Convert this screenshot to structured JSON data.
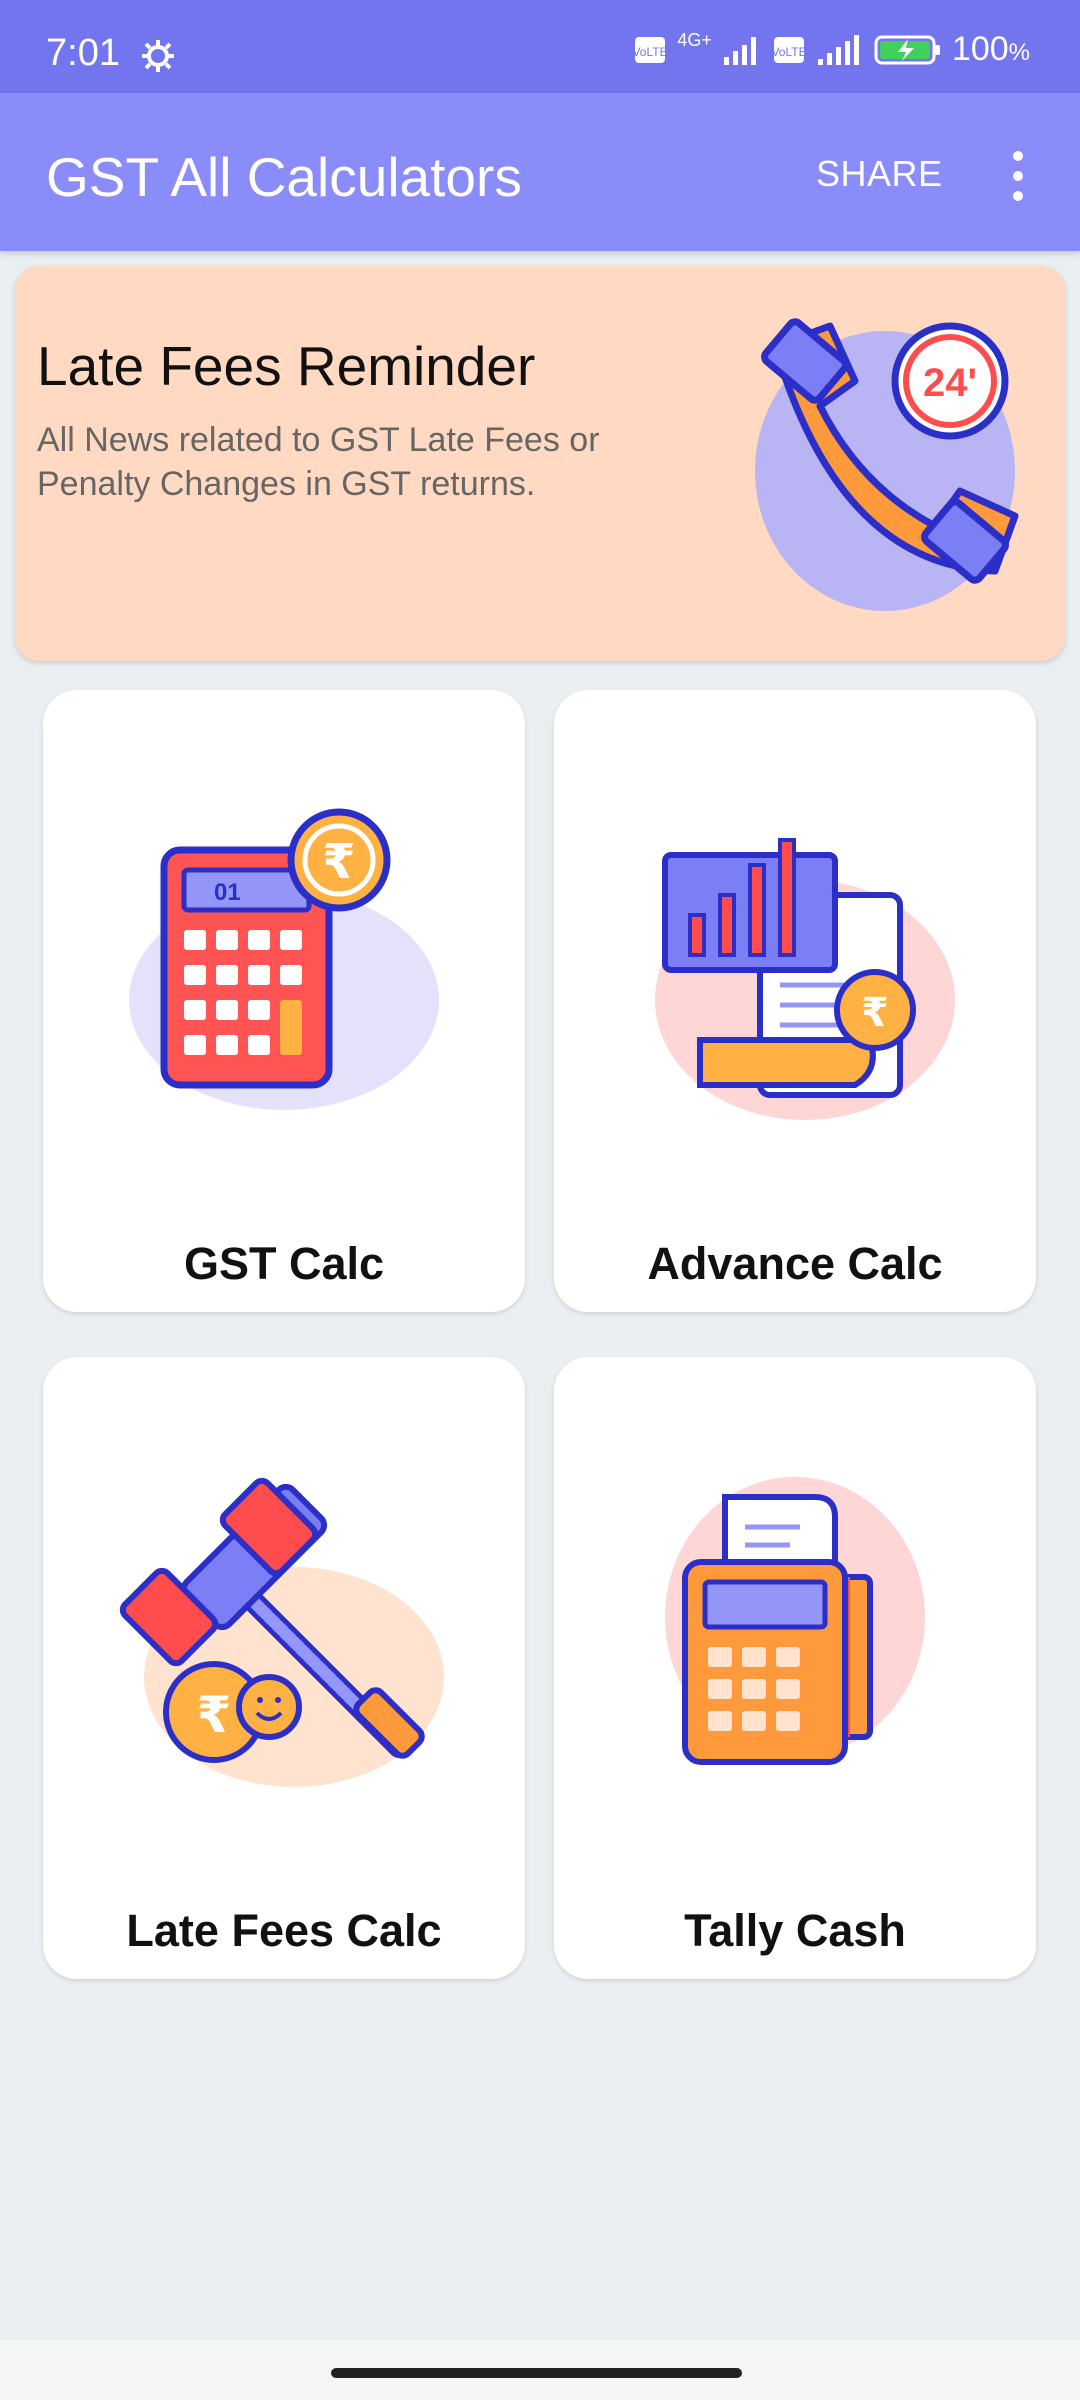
{
  "status": {
    "time": "7:01",
    "battery": "100",
    "battery_unit": "%",
    "net_label": "4G+"
  },
  "appbar": {
    "title": "GST All Calculators",
    "share": "SHARE"
  },
  "banner": {
    "title": "Late Fees Reminder",
    "subtitle": "All News related to GST Late Fees or Penalty Changes in GST returns.",
    "image_text": "24'"
  },
  "cards": [
    {
      "label": "GST Calc",
      "icon": "calculator-rupee-icon",
      "image_text": "01"
    },
    {
      "label": "Advance Calc",
      "icon": "bar-chart-receipt-icon"
    },
    {
      "label": "Late Fees Calc",
      "icon": "gavel-rupee-icon"
    },
    {
      "label": "Tally Cash",
      "icon": "pos-terminal-icon"
    }
  ],
  "colors": {
    "statusbar": "#7275ee",
    "appbar": "#8a8cf9",
    "banner": "#ffd9c2",
    "background": "#eaeff2"
  }
}
